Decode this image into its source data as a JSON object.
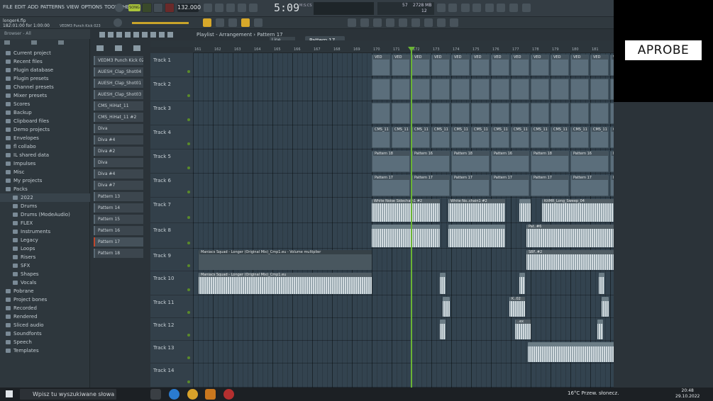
{
  "menu": [
    "FILE",
    "EDIT",
    "ADD",
    "PATTERNS",
    "VIEW",
    "OPTIONS",
    "TOOLS",
    "HELP"
  ],
  "transport": {
    "pattern_mode": "SONG",
    "tempo": "132.000",
    "time": "5:09",
    "time_sub": "M:S:CS",
    "cpu": "57",
    "mem": "2728 MB",
    "poly": "12"
  },
  "file": {
    "name": "longer4.flp",
    "pos": "182:01:00 for 1:00:00",
    "hint": "VEDM3 Punch Kick 023"
  },
  "snap": "Line",
  "pattern_selector": "Pattern 17",
  "watermark": "APROBE",
  "browser": {
    "header": "Browser - All",
    "items": [
      {
        "label": "Current project"
      },
      {
        "label": "Recent files"
      },
      {
        "label": "Plugin database"
      },
      {
        "label": "Plugin presets"
      },
      {
        "label": "Channel presets"
      },
      {
        "label": "Mixer presets"
      },
      {
        "label": "Scores"
      },
      {
        "label": "Backup"
      },
      {
        "label": "Clipboard files"
      },
      {
        "label": "Demo projects"
      },
      {
        "label": "Envelopes"
      },
      {
        "label": "fl collabo"
      },
      {
        "label": "IL shared data"
      },
      {
        "label": "Impulses"
      },
      {
        "label": "Misc"
      },
      {
        "label": "My projects"
      },
      {
        "label": "Packs"
      },
      {
        "label": "2022"
      },
      {
        "label": "Drums"
      },
      {
        "label": "Drums (ModeAudio)"
      },
      {
        "label": "FLEX"
      },
      {
        "label": "Instruments"
      },
      {
        "label": "Legacy"
      },
      {
        "label": "Loops"
      },
      {
        "label": "Risers"
      },
      {
        "label": "SFX"
      },
      {
        "label": "Shapes"
      },
      {
        "label": "Vocals"
      },
      {
        "label": "Pobrane"
      },
      {
        "label": "Project bones"
      },
      {
        "label": "Recorded"
      },
      {
        "label": "Rendered"
      },
      {
        "label": "Sliced audio"
      },
      {
        "label": "Soundfonts"
      },
      {
        "label": "Speech"
      },
      {
        "label": "Templates"
      }
    ]
  },
  "channels": [
    "VEDM3 Punch Kick 023",
    "AUESH_Clap_Shot04",
    "AUESH_Clap_Shot01",
    "AUESH_Clap_Shot03",
    "CMS_HiHat_11",
    "CMS_HiHat_11 #2",
    "Diva",
    "Diva #4",
    "Diva #2",
    "Diva",
    "Diva #4",
    "Diva #7",
    "Pattern 13",
    "Pattern 14",
    "Pattern 15",
    "Pattern 16",
    "Pattern 17",
    "Pattern 18"
  ],
  "playlist": {
    "title": "Playlist - Arrangement",
    "pattern": "Pattern 17"
  },
  "ruler": [
    "161",
    "162",
    "163",
    "164",
    "165",
    "166",
    "167",
    "168",
    "169",
    "170",
    "171",
    "172",
    "173",
    "174",
    "175",
    "176",
    "177",
    "178",
    "179",
    "180",
    "181"
  ],
  "tracks": [
    "Track 1",
    "Track 2",
    "Track 3",
    "Track 4",
    "Track 5",
    "Track 6",
    "Track 7",
    "Track 8",
    "Track 9",
    "Track 10",
    "Track 11",
    "Track 12",
    "Track 13",
    "Track 14"
  ],
  "clips": {
    "t1": "VED",
    "t4": "CMS_11",
    "t5": "Pattern 18",
    "t5b": "Pattern 16",
    "t5c": "Patt..18",
    "t6": "Pattern 17",
    "t6b": "Patt..17",
    "t7a": "White Noise Sidechain1 #2",
    "t7b": "White No..chain1 #2",
    "t7c": "KitMR_Long_Sweep_04",
    "t8": "Pat..#6",
    "t9": "Maniacs Squad - Longer (Original Mix)_Cmp1.eu - Volume multiplier",
    "t9b": "SBF..#2",
    "t10": "Maniacs Squad - Longer (Original Mix)_Cmp1.eu",
    "t11": "K..02",
    "t12": "KSH..#",
    "t12b": "..ex"
  },
  "taskbar": {
    "search": "Wpisz tu wyszukiwane słowa",
    "weather": "16°C  Przew. słonecz.",
    "time": "20:48",
    "date": "29.10.2022"
  }
}
